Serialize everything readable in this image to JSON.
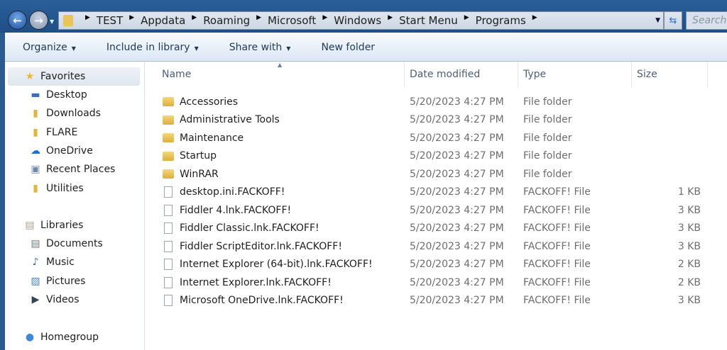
{
  "address": {
    "crumbs": [
      "TEST",
      "Appdata",
      "Roaming",
      "Microsoft",
      "Windows",
      "Start Menu",
      "Programs"
    ],
    "search_placeholder": "Search Programs"
  },
  "toolbar": {
    "organize": "Organize",
    "include": "Include in library",
    "share": "Share with",
    "new_folder": "New folder"
  },
  "sidebar": {
    "favorites": {
      "label": "Favorites",
      "items": [
        {
          "label": "Desktop",
          "icon": "desktop-icon"
        },
        {
          "label": "Downloads",
          "icon": "folder-icon"
        },
        {
          "label": "FLARE",
          "icon": "folder-icon"
        },
        {
          "label": "OneDrive",
          "icon": "cloud-icon"
        },
        {
          "label": "Recent Places",
          "icon": "recent-places-icon"
        },
        {
          "label": "Utilities",
          "icon": "folder-icon"
        }
      ]
    },
    "libraries": {
      "label": "Libraries",
      "items": [
        {
          "label": "Documents"
        },
        {
          "label": "Music"
        },
        {
          "label": "Pictures"
        },
        {
          "label": "Videos"
        }
      ]
    },
    "homegroup": "Homegroup"
  },
  "columns": {
    "name": "Name",
    "date": "Date modified",
    "type": "Type",
    "size": "Size"
  },
  "files": [
    {
      "name": "Accessories",
      "date": "5/20/2023 4:27 PM",
      "type": "File folder",
      "size": "",
      "kind": "folder"
    },
    {
      "name": "Administrative Tools",
      "date": "5/20/2023 4:27 PM",
      "type": "File folder",
      "size": "",
      "kind": "folder"
    },
    {
      "name": "Maintenance",
      "date": "5/20/2023 4:27 PM",
      "type": "File folder",
      "size": "",
      "kind": "folder"
    },
    {
      "name": "Startup",
      "date": "5/20/2023 4:27 PM",
      "type": "File folder",
      "size": "",
      "kind": "folder"
    },
    {
      "name": "WinRAR",
      "date": "5/20/2023 4:27 PM",
      "type": "File folder",
      "size": "",
      "kind": "folder"
    },
    {
      "name": "desktop.ini.FACKOFF!",
      "date": "5/20/2023 4:27 PM",
      "type": "FACKOFF! File",
      "size": "1 KB",
      "kind": "file"
    },
    {
      "name": "Fiddler 4.lnk.FACKOFF!",
      "date": "5/20/2023 4:27 PM",
      "type": "FACKOFF! File",
      "size": "3 KB",
      "kind": "file"
    },
    {
      "name": "Fiddler Classic.lnk.FACKOFF!",
      "date": "5/20/2023 4:27 PM",
      "type": "FACKOFF! File",
      "size": "3 KB",
      "kind": "file"
    },
    {
      "name": "Fiddler ScriptEditor.lnk.FACKOFF!",
      "date": "5/20/2023 4:27 PM",
      "type": "FACKOFF! File",
      "size": "3 KB",
      "kind": "file"
    },
    {
      "name": "Internet Explorer (64-bit).lnk.FACKOFF!",
      "date": "5/20/2023 4:27 PM",
      "type": "FACKOFF! File",
      "size": "2 KB",
      "kind": "file"
    },
    {
      "name": "Internet Explorer.lnk.FACKOFF!",
      "date": "5/20/2023 4:27 PM",
      "type": "FACKOFF! File",
      "size": "2 KB",
      "kind": "file"
    },
    {
      "name": "Microsoft OneDrive.lnk.FACKOFF!",
      "date": "5/20/2023 4:27 PM",
      "type": "FACKOFF! File",
      "size": "3 KB",
      "kind": "file"
    }
  ]
}
